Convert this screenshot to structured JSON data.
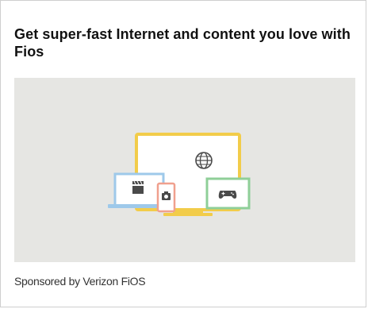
{
  "ad": {
    "headline": "Get super-fast Internet and content you love with Fios",
    "sponsor_label": "Sponsored by Verizon FiOS",
    "illustration": {
      "icons": [
        "globe-icon",
        "clapperboard-icon",
        "camera-icon",
        "gamepad-icon"
      ],
      "colors": {
        "background": "#e6e6e3",
        "monitor_frame": "#f2cc4a",
        "laptop_frame": "#9ec9ea",
        "phone_frame": "#f0a08e",
        "tablet_frame": "#8fcf98",
        "icon_dark": "#4a4a4a"
      }
    }
  }
}
